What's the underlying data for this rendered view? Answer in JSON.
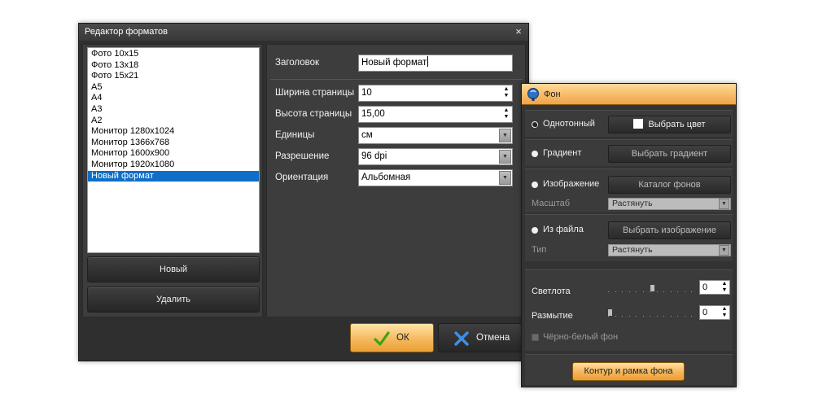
{
  "format_editor": {
    "title": "Редактор форматов",
    "close_glyph": "×",
    "formats": [
      "Фото 10x15",
      "Фото 13x18",
      "Фото 15x21",
      "A5",
      "A4",
      "A3",
      "A2",
      "Монитор 1280x1024",
      "Монитор 1366x768",
      "Монитор 1600x900",
      "Монитор 1920x1080",
      "Новый формат"
    ],
    "selected_index": 11,
    "new_button": "Новый",
    "delete_button": "Удалить",
    "fields": {
      "title_label": "Заголовок",
      "title_value": "Новый формат",
      "width_label": "Ширина страницы",
      "width_value": "10",
      "height_label": "Высота страницы",
      "height_value": "15,00",
      "units_label": "Единицы",
      "units_value": "см",
      "resolution_label": "Разрешение",
      "resolution_value": "96 dpi",
      "orientation_label": "Ориентация",
      "orientation_value": "Альбомная"
    },
    "ok_button": "ОК",
    "cancel_button": "Отмена",
    "ok_icon": "checkmark-icon",
    "cancel_icon": "cross-icon"
  },
  "background_panel": {
    "title": "Фон",
    "header_icon": "paint-icon",
    "solid_label": "Однотонный",
    "choose_color": "Выбрать цвет",
    "gradient_label": "Градиент",
    "choose_gradient": "Выбрать градиент",
    "image_label": "Изображение",
    "backgrounds_catalog": "Каталог фонов",
    "scale_label": "Масштаб",
    "scale_value": "Растянуть",
    "from_file_label": "Из файла",
    "choose_image": "Выбрать изображение",
    "type_label": "Тип",
    "type_value": "Растянуть",
    "brightness_label": "Светлота",
    "brightness_value": "0",
    "blur_label": "Размытие",
    "blur_value": "0",
    "grayscale_label": "Чёрно-белый фон",
    "outline_button": "Контур и рамка фона",
    "selected_mode": "solid"
  },
  "colors": {
    "selection": "#0f6ec7",
    "accent_orange": "#f5b95e",
    "panel_dark": "#3d3d3d"
  }
}
